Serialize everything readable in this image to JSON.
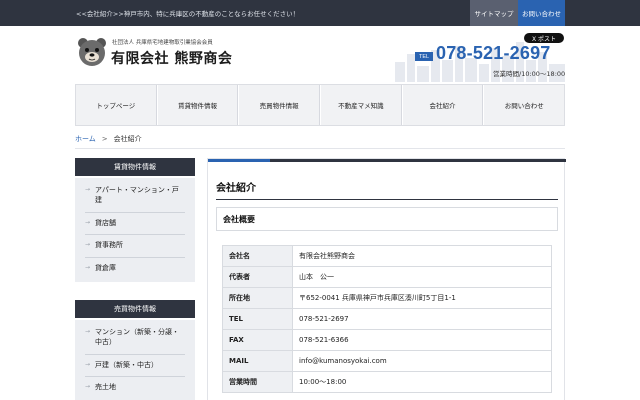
{
  "topbar": {
    "tagline": "<<会社紹介>>神戸市内、特に兵庫区の不動産のことならお任せください！",
    "sitemap": "サイトマップ",
    "contact": "お問い合わせ"
  },
  "header": {
    "association": "社団法人 兵庫県宅地建物取引業協会会員",
    "company": "有限会社 熊野商会",
    "xpost": "X ポスト",
    "tel_label": "TEL",
    "tel": "078-521-2697",
    "hours": "営業時間/10:00～18:00"
  },
  "nav": [
    {
      "label": "トップページ"
    },
    {
      "label": "賃貸物件情報"
    },
    {
      "label": "売買物件情報"
    },
    {
      "label": "不動産マメ知識"
    },
    {
      "label": "会社紹介"
    },
    {
      "label": "お問い合わせ"
    }
  ],
  "breadcrumb": {
    "home": "ホーム",
    "sep": ">",
    "current": "会社紹介"
  },
  "sidebar": {
    "rental": {
      "title": "賃貸物件情報",
      "items": [
        "アパート・マンション・戸建",
        "貸店舗",
        "貸事務所",
        "貸倉庫"
      ]
    },
    "sale": {
      "title": "売買物件情報",
      "items": [
        "マンション（新築・分譲・中古）",
        "戸建（新築・中古）",
        "売土地"
      ]
    }
  },
  "main": {
    "title": "会社紹介",
    "section": "会社概要",
    "rows": [
      {
        "label": "会社名",
        "value": "有限会社熊野商会"
      },
      {
        "label": "代表者",
        "value": "山本　公一"
      },
      {
        "label": "所在地",
        "value": "〒652-0041 兵庫県神戸市兵庫区湊川町5丁目1-1"
      },
      {
        "label": "TEL",
        "value": "078-521-2697"
      },
      {
        "label": "FAX",
        "value": "078-521-6366"
      },
      {
        "label": "MAIL",
        "value": "info@kumanosyokai.com"
      },
      {
        "label": "営業時間",
        "value": "10:00～18:00"
      }
    ]
  },
  "colors": {
    "accent": "#2a63b1",
    "dark": "#2f3440",
    "panel": "#eceef2"
  },
  "icons": [
    "bear-logo-icon",
    "city-skyline-icon",
    "arrow-right-icon"
  ]
}
